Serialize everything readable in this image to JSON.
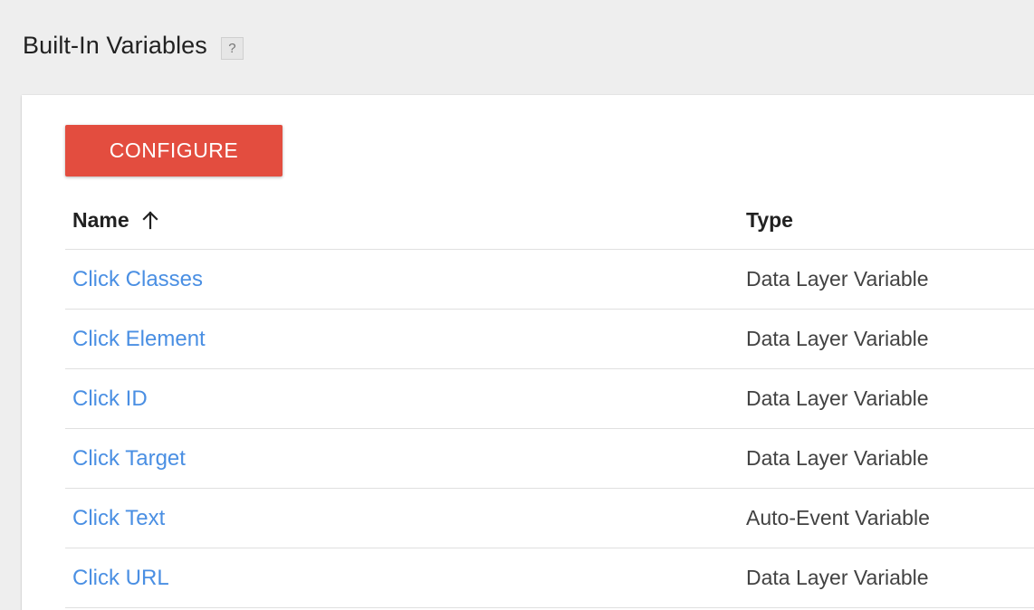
{
  "page": {
    "title": "Built-In Variables",
    "help_label": "?"
  },
  "toolbar": {
    "configure_label": "CONFIGURE"
  },
  "table": {
    "columns": {
      "name": "Name",
      "type": "Type"
    },
    "sort": "ascending",
    "rows": [
      {
        "name": "Click Classes",
        "type": "Data Layer Variable"
      },
      {
        "name": "Click Element",
        "type": "Data Layer Variable"
      },
      {
        "name": "Click ID",
        "type": "Data Layer Variable"
      },
      {
        "name": "Click Target",
        "type": "Data Layer Variable"
      },
      {
        "name": "Click Text",
        "type": "Auto-Event Variable"
      },
      {
        "name": "Click URL",
        "type": "Data Layer Variable"
      }
    ]
  },
  "colors": {
    "accent": "#e34d3f",
    "link": "#4a8fe3",
    "background": "#eeeeee"
  },
  "icons": {
    "help": "help-icon",
    "sort": "arrow-up-icon"
  }
}
